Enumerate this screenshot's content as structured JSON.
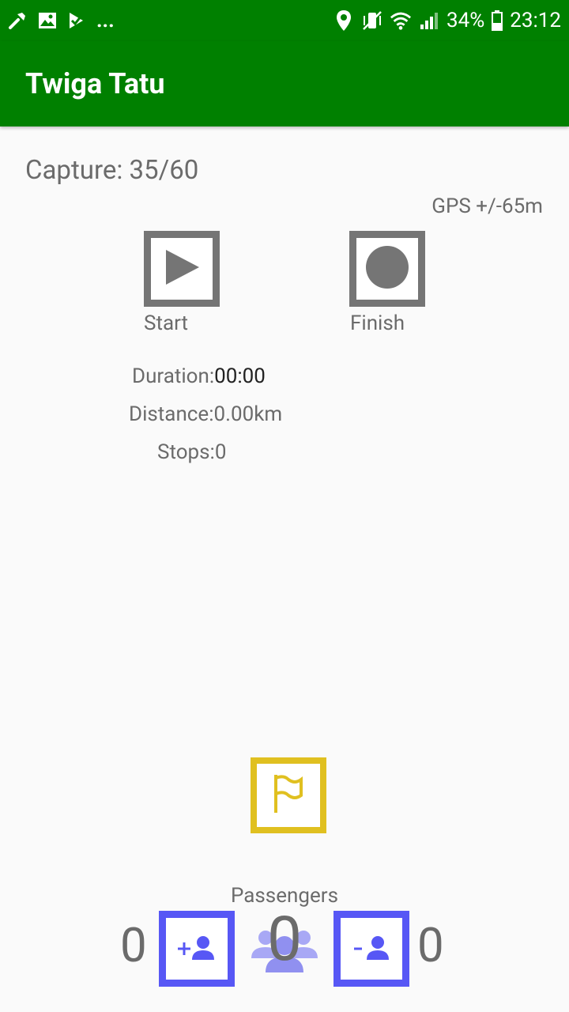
{
  "status_bar": {
    "left_icons": [
      "wrench-icon",
      "image-icon",
      "task-check-icon"
    ],
    "overflow": "...",
    "right_icons": [
      "location-pin-icon",
      "vibrate-mute-icon",
      "wifi-icon",
      "cell-signal-icon"
    ],
    "battery_percent": "34%",
    "time": "23:12"
  },
  "app_bar": {
    "title": "Twiga Tatu",
    "color": "#008000"
  },
  "capture": {
    "text": "Capture: 35/60"
  },
  "gps": {
    "text": "GPS +/-65m"
  },
  "controls": {
    "start_label": "Start",
    "finish_label": "Finish"
  },
  "stats": {
    "duration_label": "Duration:",
    "duration_value": "00:00",
    "distance_text": "Distance:0.00km",
    "stops_text": "Stops:0"
  },
  "flag_button": {
    "icon": "flag-icon",
    "color": "#e0c020"
  },
  "passengers": {
    "label": "Passengers",
    "left_count": "0",
    "center_count": "0",
    "right_count": "0",
    "add_icon": "add-person-icon",
    "remove_icon": "remove-person-icon",
    "accent": "#5757f5"
  }
}
